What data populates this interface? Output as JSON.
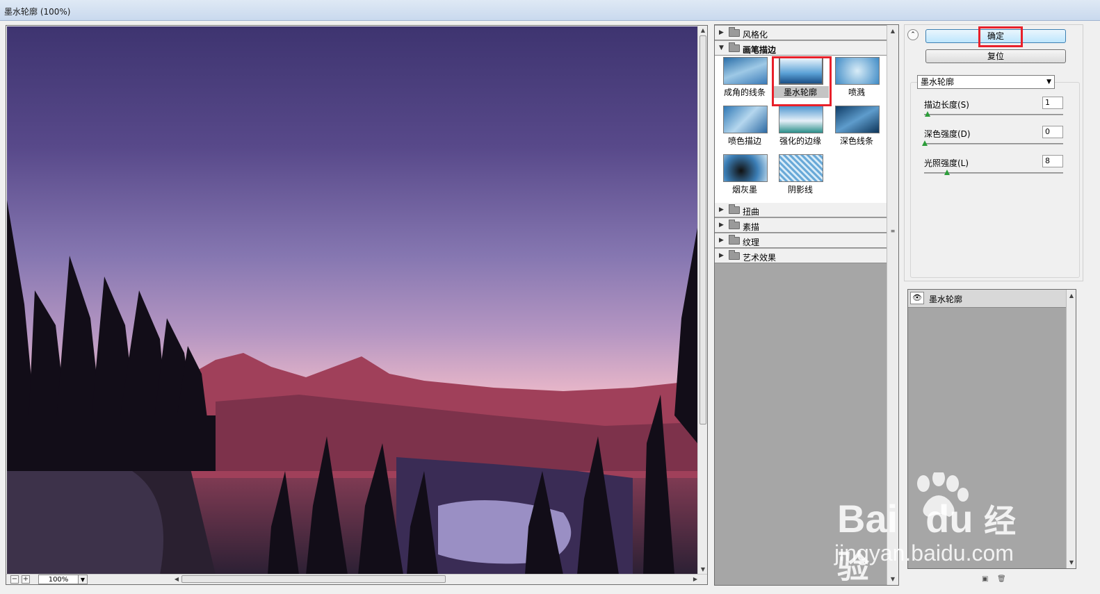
{
  "window": {
    "title": "墨水轮廓 (100%)"
  },
  "preview": {
    "zoom": "100%",
    "zoom_out": "−",
    "zoom_in": "+"
  },
  "filter_gallery": {
    "categories_top": [
      {
        "label": "风格化",
        "expanded": false
      },
      {
        "label": "画笔描边",
        "expanded": true
      }
    ],
    "brush_filters": [
      {
        "label": "成角的线条",
        "icon": "angled-strokes-thumb"
      },
      {
        "label": "墨水轮廓",
        "icon": "ink-outlines-thumb",
        "selected": true
      },
      {
        "label": "喷溅",
        "icon": "spatter-thumb"
      },
      {
        "label": "喷色描边",
        "icon": "sprayed-strokes-thumb"
      },
      {
        "label": "强化的边缘",
        "icon": "accented-edges-thumb"
      },
      {
        "label": "深色线条",
        "icon": "dark-strokes-thumb"
      },
      {
        "label": "烟灰墨",
        "icon": "sumi-e-thumb"
      },
      {
        "label": "阴影线",
        "icon": "crosshatch-thumb"
      }
    ],
    "categories_bottom": [
      {
        "label": "扭曲"
      },
      {
        "label": "素描"
      },
      {
        "label": "纹理"
      },
      {
        "label": "艺术效果"
      }
    ]
  },
  "controls": {
    "ok_label": "确定",
    "reset_label": "复位",
    "filter_select": "墨水轮廓",
    "params": [
      {
        "label": "描边长度(S)",
        "value": "1",
        "fraction": 0.02
      },
      {
        "label": "深色强度(D)",
        "value": "0",
        "fraction": 0.0
      },
      {
        "label": "光照强度(L)",
        "value": "8",
        "fraction": 0.16
      }
    ]
  },
  "effect_layers": [
    {
      "label": "墨水轮廓",
      "visible": true
    }
  ],
  "watermark": {
    "brand": "Bai",
    "brand2": "du",
    "cn": "经验",
    "url": "jingyan.baidu.com"
  },
  "colors": {
    "highlight": "#e8202a",
    "slider_knob": "#2c9d3a",
    "ok_button": "#bee6fd"
  }
}
